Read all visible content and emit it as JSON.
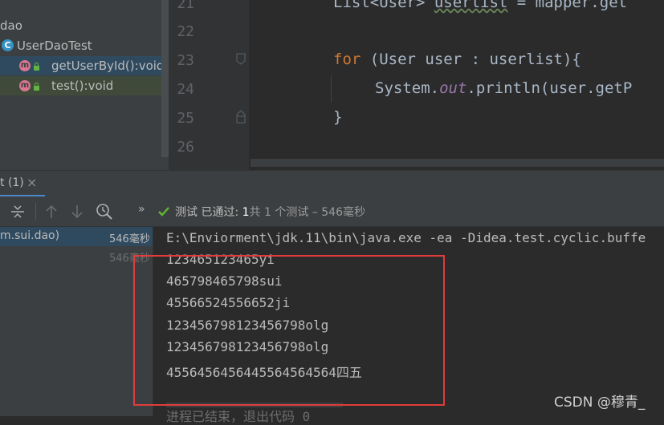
{
  "project_tree": {
    "package_label": "dao",
    "class_label": "UserDaoTest",
    "class_icon_letter": "C",
    "methods": [
      {
        "label": "getUserById():void",
        "icon_letter": "m"
      },
      {
        "label": "test():void",
        "icon_letter": "m"
      }
    ]
  },
  "editor": {
    "line_numbers": [
      "21",
      "22",
      "23",
      "24",
      "25",
      "26"
    ],
    "lines": {
      "l21_type": "List<User> ",
      "l21_var": "userlist",
      "l21_rest": " = mapper.get",
      "l23_kw": "for",
      "l23_rest": " (User user : userlist){",
      "l24_a": "System.",
      "l24_field": "out",
      "l24_b": ".println(user.getP",
      "l25": "}"
    }
  },
  "run_panel": {
    "tab_label": "t (1)",
    "tab_close": "×",
    "status_prefix": "测试 已通过: ",
    "status_count": "1",
    "status_rest": "共 1 个测试 – 546毫秒",
    "expand_marker": "»",
    "tree_items": [
      {
        "label": "m.sui.dao)",
        "time": "546毫秒"
      },
      {
        "label": "",
        "time": "546毫秒"
      }
    ]
  },
  "console": {
    "command": "E:\\Enviorment\\jdk.11\\bin\\java.exe -ea -Didea.test.cyclic.buffe",
    "output_lines": [
      "123465123465yi",
      "465798465798sui",
      "45566524556652ji",
      "123456798123456798olg",
      "123456798123456798olg",
      "4556456456445564564564四五"
    ],
    "partial_bottom": "进程已结束，退出代码 0"
  },
  "watermark": "CSDN @穆青_"
}
